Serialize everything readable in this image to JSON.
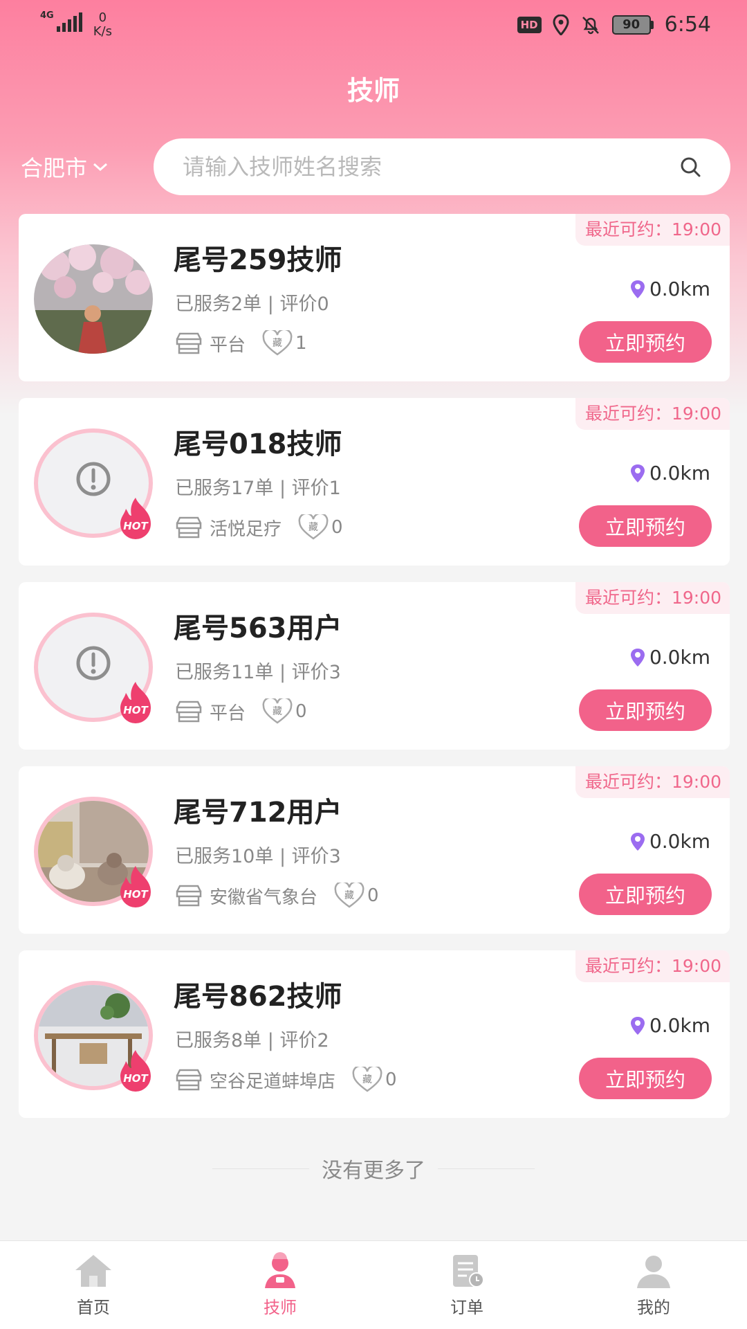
{
  "status_bar": {
    "network": "4G",
    "speed_value": "0",
    "speed_unit": "K/s",
    "hd": "HD",
    "battery": "90",
    "time": "6:54"
  },
  "header": {
    "title": "技师"
  },
  "city": {
    "label": "合肥市"
  },
  "search": {
    "placeholder": "请输入技师姓名搜索"
  },
  "technicians": [
    {
      "name": "尾号259技师",
      "served": "已服务2单 | 评价0",
      "shop": "平台",
      "favorites": "1",
      "fav_label": "藏",
      "distance": "0.0km",
      "recent": "最近可约：19:00",
      "book": "立即预约",
      "hot": false,
      "avatar": "photo-blossom"
    },
    {
      "name": "尾号018技师",
      "served": "已服务17单 | 评价1",
      "shop": "活悦足疗",
      "favorites": "0",
      "fav_label": "藏",
      "distance": "0.0km",
      "recent": "最近可约：19:00",
      "book": "立即预约",
      "hot": true,
      "avatar": "placeholder"
    },
    {
      "name": "尾号563用户",
      "served": "已服务11单 | 评价3",
      "shop": "平台",
      "favorites": "0",
      "fav_label": "藏",
      "distance": "0.0km",
      "recent": "最近可约：19:00",
      "book": "立即预约",
      "hot": true,
      "avatar": "placeholder"
    },
    {
      "name": "尾号712用户",
      "served": "已服务10单 | 评价3",
      "shop": "安徽省气象台",
      "favorites": "0",
      "fav_label": "藏",
      "distance": "0.0km",
      "recent": "最近可约：19:00",
      "book": "立即预约",
      "hot": true,
      "avatar": "photo-cats"
    },
    {
      "name": "尾号862技师",
      "served": "已服务8单 | 评价2",
      "shop": "空谷足道蚌埠店",
      "favorites": "0",
      "fav_label": "藏",
      "distance": "0.0km",
      "recent": "最近可约：19:00",
      "book": "立即预约",
      "hot": true,
      "avatar": "photo-room"
    }
  ],
  "hot_label": "HOT",
  "footer": {
    "no_more": "没有更多了"
  },
  "tabbar": [
    {
      "label": "首页",
      "icon": "home-icon",
      "active": false
    },
    {
      "label": "技师",
      "icon": "technician-icon",
      "active": true
    },
    {
      "label": "订单",
      "icon": "order-icon",
      "active": false
    },
    {
      "label": "我的",
      "icon": "profile-icon",
      "active": false
    }
  ],
  "colors": {
    "primary": "#f2628a",
    "header_gradient_top": "#fd7f9f",
    "recent_bg": "#fdeef2",
    "location_pin": "#9b6cf0"
  }
}
